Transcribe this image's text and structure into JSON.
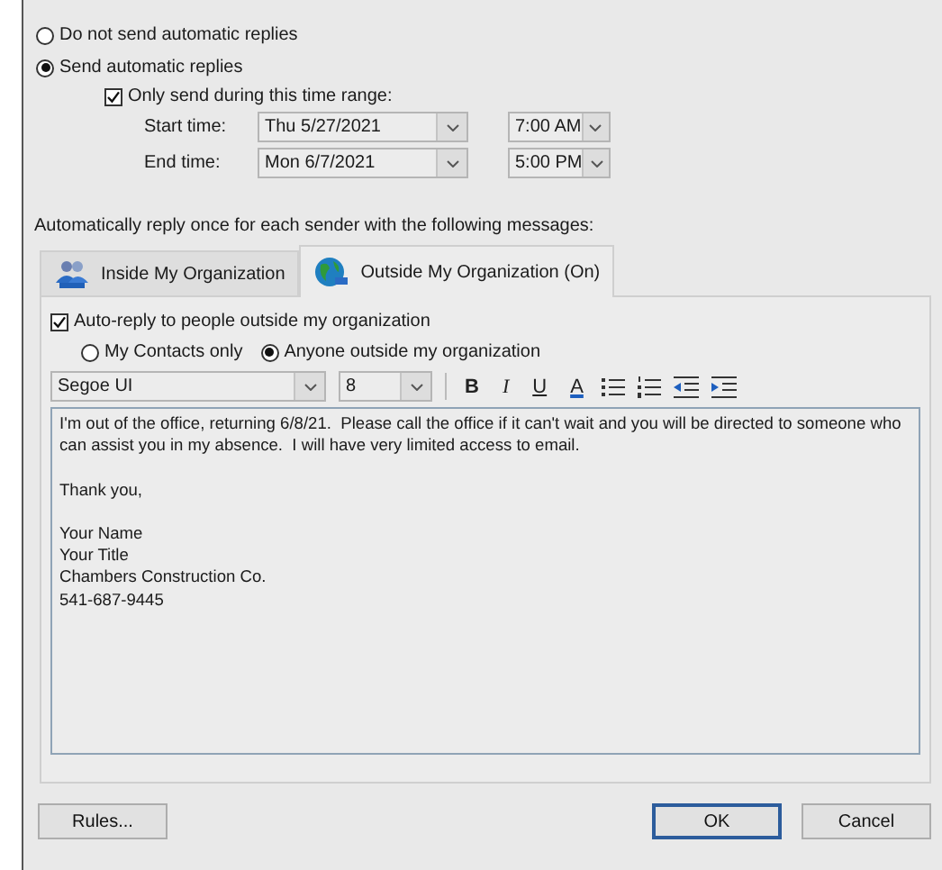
{
  "reply_mode": [
    {
      "label": "Do not send automatic replies",
      "selected": false
    },
    {
      "label": "Send automatic replies",
      "selected": true
    }
  ],
  "time_range": {
    "label": "Only send during this time range:",
    "checked": true,
    "rows": [
      {
        "label": "Start time:",
        "date": "Thu 5/27/2021",
        "time": "7:00 AM"
      },
      {
        "label": "End time:",
        "date": "Mon 6/7/2021",
        "time": "5:00 PM"
      }
    ]
  },
  "instruction": "Automatically reply once for each sender with the following messages:",
  "tabs": [
    {
      "label": "Inside My Organization",
      "kind": "people",
      "selected": false
    },
    {
      "label": "Outside My Organization (On)",
      "kind": "globe",
      "selected": true
    }
  ],
  "auto_reply": {
    "label": "Auto-reply to people outside my organization",
    "checked": true
  },
  "audience": [
    {
      "label": "My Contacts only",
      "selected": false
    },
    {
      "label": "Anyone outside my organization",
      "selected": true
    }
  ],
  "toolbar": {
    "font": "Segoe UI",
    "size": "8",
    "format_buttons": [
      {
        "label": "B",
        "kind": "bold"
      },
      {
        "label": "I",
        "kind": "italic"
      },
      {
        "label": "U",
        "kind": "underline"
      },
      {
        "label": "A",
        "kind": "color"
      }
    ]
  },
  "message": [
    [
      "I'm out of the office, returning 6/8/21.  Please call the office if it can't wait and you will be directed to someone who can assist you in my absence.  I will have very limited access to email."
    ],
    [
      "Thank you,"
    ],
    [
      "Your Name",
      "Your Title",
      "Chambers Construction Co.",
      "541-687-9445"
    ]
  ],
  "buttons": [
    {
      "label": "Rules...",
      "kind": "normal"
    },
    {
      "label": "OK",
      "kind": "default"
    },
    {
      "label": "Cancel",
      "kind": "normal"
    }
  ]
}
